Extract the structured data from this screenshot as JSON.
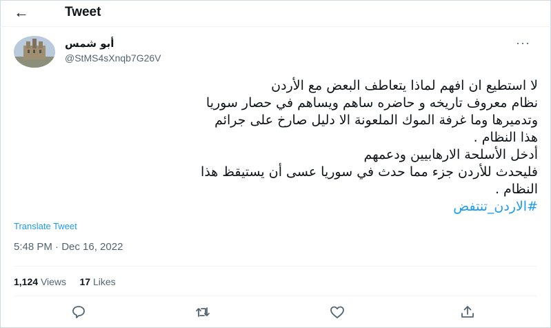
{
  "header": {
    "back_icon": "arrow-left-icon",
    "title": "Tweet"
  },
  "author": {
    "display_name": "أبو شمس",
    "handle": "@StMS4sXnqb7G26V",
    "more_icon": "more-dots-icon"
  },
  "tweet": {
    "lines": [
      "لا استطيع ان افهم لماذا يتعاطف البعض مع الأردن",
      "نظام معروف تاريخه و حاضره ساهم ويساهم في حصار سوريا",
      "وتدميرها وما غرفة الموك الملعونة الا دليل صارخ على جرائم",
      "هذا النظام .",
      "أدخل الأسلحة الارهابيين ودعمهم",
      "فليحدث  للأردن جزء مما حدث في سوريا عسى أن يستيقظ هذا",
      "النظام ."
    ],
    "hashtag": "#الاردن_تنتفض"
  },
  "translate_label": "Translate Tweet",
  "timestamp": "5:48 PM · Dec 16, 2022",
  "stats": {
    "views_count": "1,124",
    "views_label": "Views",
    "likes_count": "17",
    "likes_label": "Likes"
  },
  "actions": [
    "reply-icon",
    "retweet-icon",
    "like-icon",
    "share-icon"
  ],
  "colors": {
    "accent": "#1d9bf0",
    "text": "#0f1419",
    "secondary": "#536471",
    "divider": "#eff3f4"
  }
}
